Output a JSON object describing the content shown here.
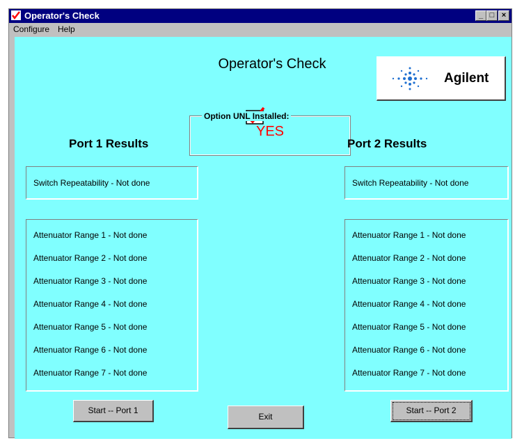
{
  "window": {
    "title": "Operator's Check"
  },
  "menu": [
    "Configure",
    "Help"
  ],
  "heading": "Operator's Check",
  "logo": {
    "brand": "Agilent"
  },
  "option": {
    "label": "Option UNL Installed:",
    "value": "YES"
  },
  "port1": {
    "title": "Port 1 Results",
    "switch": "Switch Repeatability - Not done",
    "ranges": [
      "Attenuator Range 1 - Not done",
      "Attenuator Range 2 - Not done",
      "Attenuator Range 3 - Not done",
      "Attenuator Range 4 - Not done",
      "Attenuator Range 5 - Not done",
      "Attenuator Range 6 - Not done",
      "Attenuator Range 7 - Not done"
    ],
    "button": "Start -- Port 1"
  },
  "port2": {
    "title": "Port 2 Results",
    "switch": "Switch Repeatability - Not done",
    "ranges": [
      "Attenuator Range 1 - Not done",
      "Attenuator Range 2 - Not done",
      "Attenuator Range 3 - Not done",
      "Attenuator Range 4 - Not done",
      "Attenuator Range 5 - Not done",
      "Attenuator Range 6 - Not done",
      "Attenuator Range 7 - Not done"
    ],
    "button": "Start -- Port 2"
  },
  "exit_button": "Exit",
  "colors": {
    "client_bg": "#80ffff",
    "titlebar": "#000080",
    "option_value": "#ff0000",
    "logo_blue": "#1e6fd0"
  }
}
